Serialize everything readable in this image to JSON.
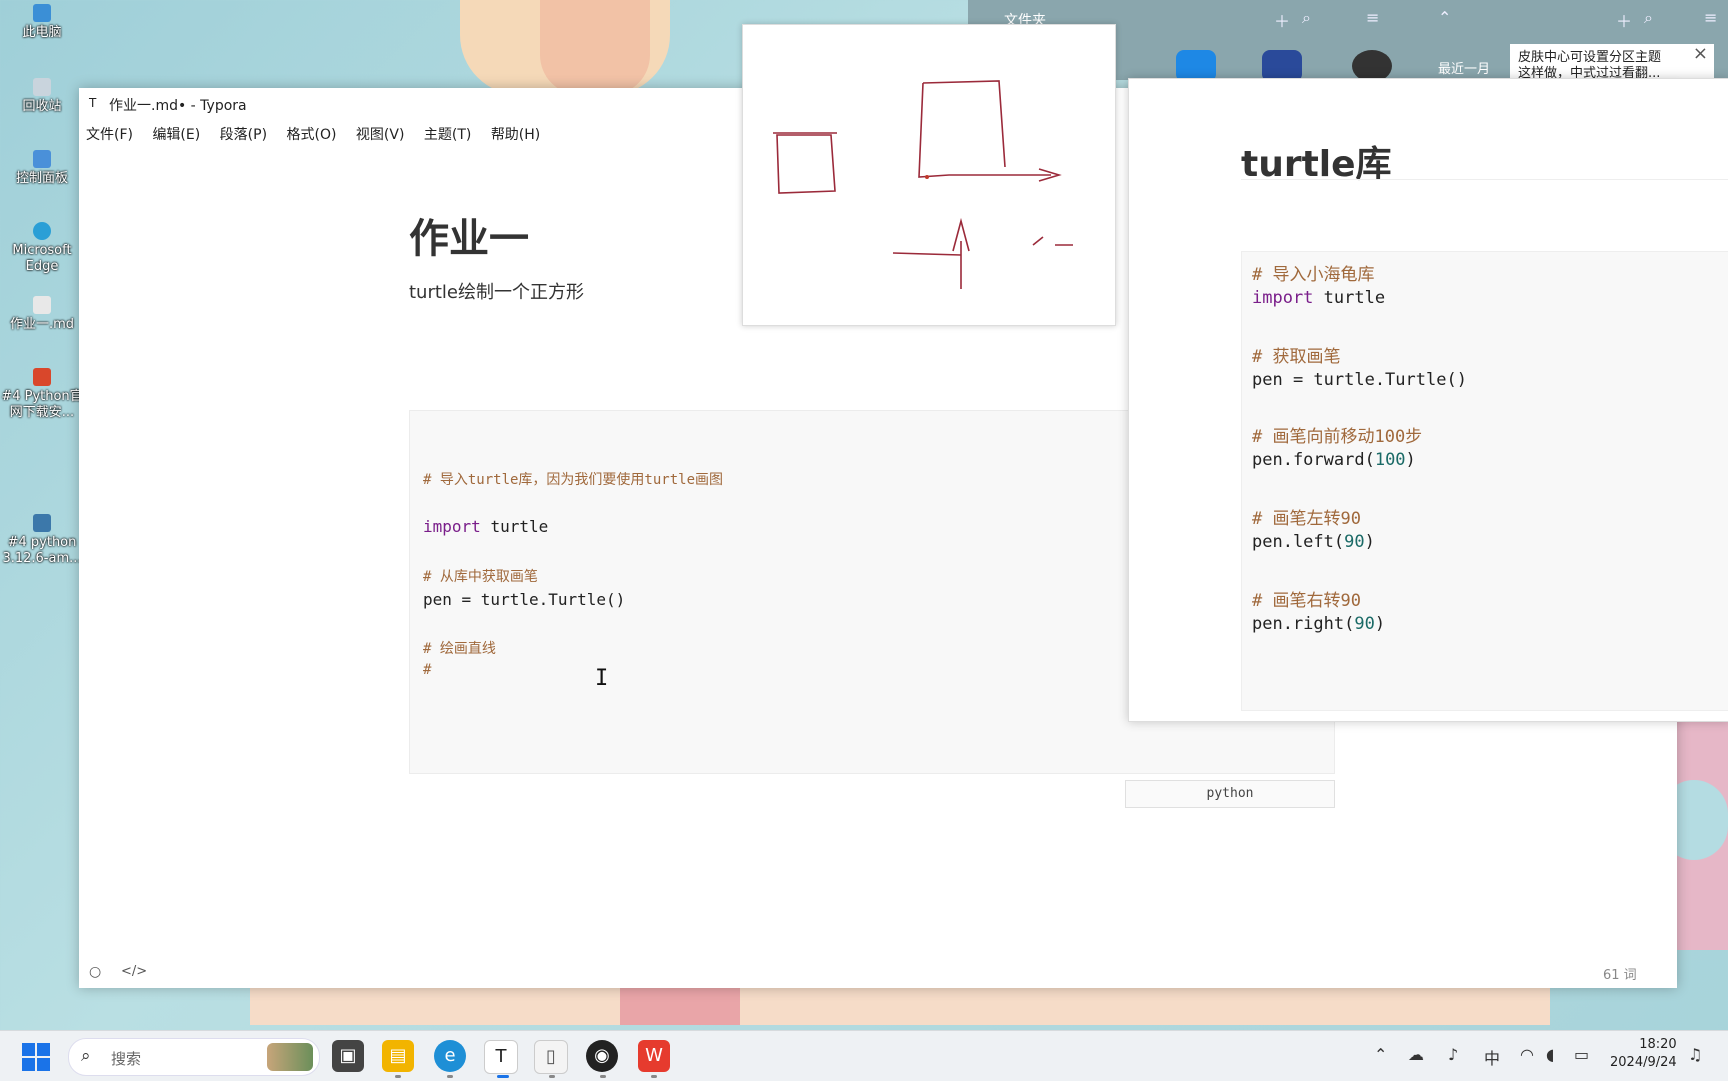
{
  "desktop_icons": [
    {
      "label": "此电脑",
      "color": "#3b8fd6"
    },
    {
      "label": "回收站",
      "color": "#c9d4dd"
    },
    {
      "label": "控制面板",
      "color": "#4a90d9"
    },
    {
      "label": "Microsoft Edge",
      "color": "#2a9fd6"
    },
    {
      "label": "作业一.md",
      "color": "#e8e8e8"
    },
    {
      "label": "#4 Python官网下载安...",
      "color": "#d9472b"
    },
    {
      "label": "#4 python 3.12.6-am...",
      "color": "#3c78aa"
    }
  ],
  "explorer": {
    "title": "文件夹",
    "recent": "最近一月"
  },
  "toast": {
    "text": "皮肤中心可设置分区主题",
    "text2": "这样做，中式过过看翻..."
  },
  "typora": {
    "window_title": "作业一.md• - Typora",
    "menu": [
      "文件(F)",
      "编辑(E)",
      "段落(P)",
      "格式(O)",
      "视图(V)",
      "主题(T)",
      "帮助(H)"
    ],
    "doc_title": "作业一",
    "doc_subtitle": "turtle绘制一个正方形",
    "code": {
      "comment1": "# 导入turtle库，因为我们要使用turtle画图",
      "import_kw": "import",
      "import_mod": "turtle",
      "comment2": "# 从库中获取画笔",
      "pen_line": "pen = turtle.Turtle()",
      "comment3": "# 绘画直线",
      "comment4": "#"
    },
    "code_language": "python",
    "word_count": "61 词"
  },
  "reference": {
    "title": "turtle库",
    "lines": [
      {
        "type": "comment",
        "text": "# 导入小海龟库"
      },
      {
        "type": "code",
        "kw": "import",
        "text": " turtle"
      },
      {
        "type": "comment",
        "text": "# 获取画笔"
      },
      {
        "type": "code",
        "kw": "",
        "text": "pen = turtle.Turtle()"
      },
      {
        "type": "comment",
        "text": "# 画笔向前移动100步"
      },
      {
        "type": "code",
        "kw": "",
        "text": "pen.forward(",
        "num": "100",
        "end": ")"
      },
      {
        "type": "comment",
        "text": "# 画笔左转90"
      },
      {
        "type": "code",
        "kw": "",
        "text": "pen.left(",
        "num": "90",
        "end": ")"
      },
      {
        "type": "comment",
        "text": "# 画笔右转90"
      },
      {
        "type": "code",
        "kw": "",
        "text": "pen.right(",
        "num": "90",
        "end": ")"
      }
    ]
  },
  "taskbar": {
    "search_placeholder": "搜索",
    "ime": "中",
    "time": "18:20",
    "date": "2024/9/24"
  },
  "colors": {
    "accent": "#1a73e8",
    "comment": "#a0693c",
    "keyword": "#7a1e8a",
    "number": "#1a6a66"
  }
}
